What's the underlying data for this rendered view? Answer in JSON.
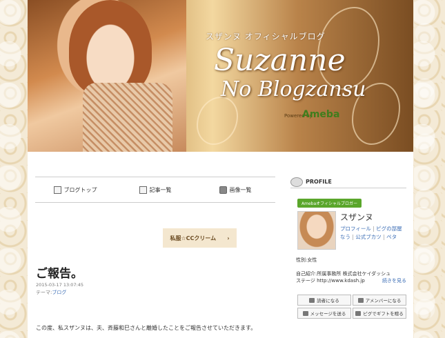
{
  "header": {
    "subtitle": "スザンヌ オフィシャルブログ",
    "title_line1": "Suzanne",
    "title_line2": "No Blogzansu",
    "powered_by": "Powered by",
    "ameba": "Ameba"
  },
  "nav": {
    "items": [
      {
        "label": "ブログトップ",
        "icon": "document-icon"
      },
      {
        "label": "記事一覧",
        "icon": "list-icon"
      },
      {
        "label": "画像一覧",
        "icon": "camera-icon"
      }
    ]
  },
  "reader_button": {
    "label": "私服☆CCクリーム",
    "arrow": "›"
  },
  "post": {
    "title": "ご報告。",
    "date": "2015-03-17 13:07:45",
    "theme_label": "テーマ:",
    "theme_value": "ブログ",
    "body": "この度、私スザンヌは、夫、斉藤和巳さんと離婚したことをご報告させていただきます。"
  },
  "profile": {
    "header": "PROFILE",
    "badge": "Amebaオフィシャルブロガー",
    "name": "スザンヌ",
    "links_line1": [
      "プロフィール",
      "ピグの部屋"
    ],
    "links_line2": [
      "なう",
      "公式ブカツ",
      "ペタ"
    ],
    "gender": "性別:女性",
    "intro_line1": "自己紹介:所属事務所 株式会社ケイダッシュ",
    "intro_line2": "ステージ http://www.kdash.jp",
    "more": "続きを見る",
    "buttons": [
      {
        "label": "読者になる",
        "icon": "reader-icon"
      },
      {
        "label": "アメンバーになる",
        "icon": "member-icon"
      },
      {
        "label": "メッセージを送る",
        "icon": "mail-icon"
      },
      {
        "label": "ピグでギフトを贈る",
        "icon": "gift-icon"
      }
    ]
  }
}
